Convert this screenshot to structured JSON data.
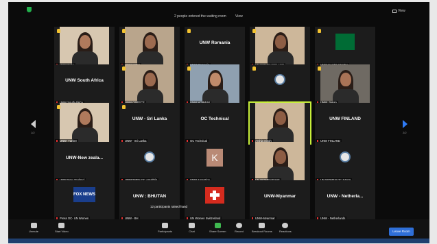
{
  "header": {
    "waiting_text": "2 people entered the waiting room",
    "view_button": "View",
    "view_menu": "View"
  },
  "tiles": [
    {
      "label": "UNW Cuba",
      "name": "",
      "type": "video",
      "hand": true
    },
    {
      "label": "UNW INDIA",
      "name": "",
      "type": "video",
      "hand": true
    },
    {
      "label": "UNW Romania",
      "name": "UNW Romania",
      "type": "name",
      "hand": true
    },
    {
      "label": "UN WOMEN POLAND",
      "name": "",
      "type": "video",
      "hand": true
    },
    {
      "label": "UNW SAUDI ARABIA",
      "name": "",
      "type": "flag",
      "hand": true
    },
    {
      "label": "UNW South Africa",
      "name": "UNW South Africa",
      "type": "name",
      "hand": false
    },
    {
      "label": "UNW GREECE",
      "name": "",
      "type": "video",
      "hand": true
    },
    {
      "label": "UNW NORWAY",
      "name": "",
      "type": "video",
      "hand": true
    },
    {
      "label": "UNW_Colombia",
      "name": "",
      "type": "emblem",
      "hand": true
    },
    {
      "label": "UNW_Japan",
      "name": "",
      "type": "video",
      "hand": true
    },
    {
      "label": "UNW_Turkey",
      "name": "",
      "type": "video",
      "hand": true
    },
    {
      "label": "UNW - Sri Lanka",
      "name": "UNW - Sri Lanka",
      "type": "name",
      "hand": true
    },
    {
      "label": "OC Technical",
      "name": "OC Technical",
      "type": "name",
      "hand": false
    },
    {
      "label": "Arshia Singh",
      "name": "",
      "type": "video",
      "hand": false,
      "active": true
    },
    {
      "label": "UNW FINLAND",
      "name": "UNW FINLAND",
      "type": "name",
      "hand": false
    },
    {
      "label": "UNW New Zealand",
      "name": "UNW-New zeala...",
      "type": "name",
      "hand": false
    },
    {
      "label": "UNWOMEN OC Amalthia",
      "name": "",
      "type": "emblem",
      "hand": false
    },
    {
      "label": "UNW Argentina",
      "name": "",
      "type": "avatar",
      "avatar": "K",
      "hand": false
    },
    {
      "label": "UN WOMEN Egypt",
      "name": "",
      "type": "video",
      "hand": false
    },
    {
      "label": "UN WOMEN OC SAVIA",
      "name": "",
      "type": "emblem",
      "hand": false
    },
    {
      "label": "Press OC- UN Women",
      "name": "",
      "type": "logo",
      "logo": "FOX NEWS",
      "hand": false
    },
    {
      "label": "UNW - BH",
      "name": "UNW : BHUTAN",
      "type": "name",
      "hand": false
    },
    {
      "label": "UN Women Switzerland",
      "name": "",
      "type": "flag",
      "hand": false
    },
    {
      "label": "UNW-Myanmar",
      "name": "UNW-Myanmar",
      "type": "name",
      "hand": false
    },
    {
      "label": "UNW - Netherlands",
      "name": "UNW - Netherla...",
      "type": "name",
      "hand": false
    }
  ],
  "notice": "12 participants raised hand",
  "pager": {
    "left": "1/2",
    "right": "2/2"
  },
  "toolbar": {
    "unmute": "Unmute",
    "start_video": "Start Video",
    "participants": "Participants",
    "participants_count": "26",
    "chat": "Chat",
    "share_screen": "Share Screen",
    "record": "Record",
    "breakout": "Breakout Rooms",
    "reactions": "Reactions",
    "leave": "Leave Room"
  }
}
